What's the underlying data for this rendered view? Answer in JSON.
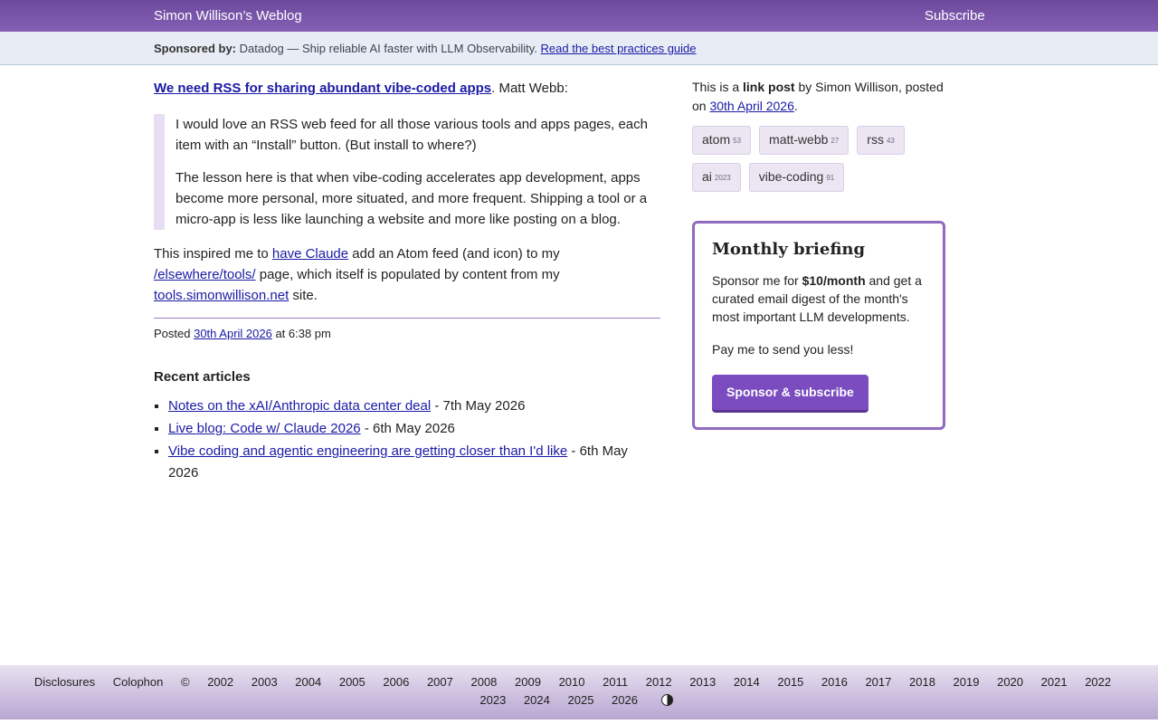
{
  "header": {
    "site_title": "Simon Willison’s Weblog",
    "subscribe_label": "Subscribe"
  },
  "sponsor": {
    "label": "Sponsored by:",
    "text": "Datadog — Ship reliable AI faster with LLM Observability.",
    "link_text": "Read the best practices guide"
  },
  "post": {
    "title_link": "We need RSS for sharing abundant vibe-coded apps",
    "source": ". Matt Webb:",
    "quote": [
      "I would love an RSS web feed for all those various tools and apps pages, each item with an “Install” button. (But install to where?)",
      "The lesson here is that when vibe-coding accelerates app development, apps become more personal, more situated, and more frequent. Shipping a tool or a micro-app is less like launching a website and more like posting on a blog."
    ],
    "body": {
      "t1": "This inspired me to ",
      "link1": "have Claude",
      "t2": " add an Atom feed (and icon) to my ",
      "link2": "/elsewhere/tools/",
      "t3": " page, which itself is populated by content from my ",
      "link3": "tools.simonwillison.net",
      "t4": " site."
    },
    "posted_prefix": "Posted ",
    "posted_date": "30th April 2026",
    "posted_time": " at 6:38 pm"
  },
  "recent": {
    "heading": "Recent articles",
    "items": [
      {
        "title": "Notes on the xAI/Anthropic data center deal",
        "date": " - 7th May 2026"
      },
      {
        "title": "Live blog: Code w/ Claude 2026",
        "date": " - 6th May 2026"
      },
      {
        "title": "Vibe coding and agentic engineering are getting closer than I'd like",
        "date": " - 6th May 2026"
      }
    ]
  },
  "sidebar": {
    "meta_t1": "This is a ",
    "meta_bold": "link post",
    "meta_t2": " by Simon Willison, posted on ",
    "meta_date": "30th April 2026",
    "meta_t3": ".",
    "tags": [
      {
        "name": "atom",
        "count": "53"
      },
      {
        "name": "matt-webb",
        "count": "27"
      },
      {
        "name": "rss",
        "count": "43"
      },
      {
        "name": "ai",
        "count": "2023"
      },
      {
        "name": "vibe-coding",
        "count": "91"
      }
    ],
    "briefing": {
      "title": "Monthly briefing",
      "p1_t1": "Sponsor me for ",
      "p1_bold": "$10/month",
      "p1_t2": " and get a curated email digest of the month's most important LLM developments.",
      "p2": "Pay me to send you less!",
      "button": "Sponsor & subscribe"
    }
  },
  "footer": {
    "links": [
      "Disclosures",
      "Colophon",
      "©",
      "2002",
      "2003",
      "2004",
      "2005",
      "2006",
      "2007",
      "2008",
      "2009",
      "2010",
      "2011",
      "2012",
      "2013",
      "2014",
      "2015",
      "2016",
      "2017",
      "2018",
      "2019",
      "2020",
      "2021",
      "2022",
      "2023",
      "2024",
      "2025",
      "2026"
    ],
    "contrast_icon": "contrast-icon"
  }
}
